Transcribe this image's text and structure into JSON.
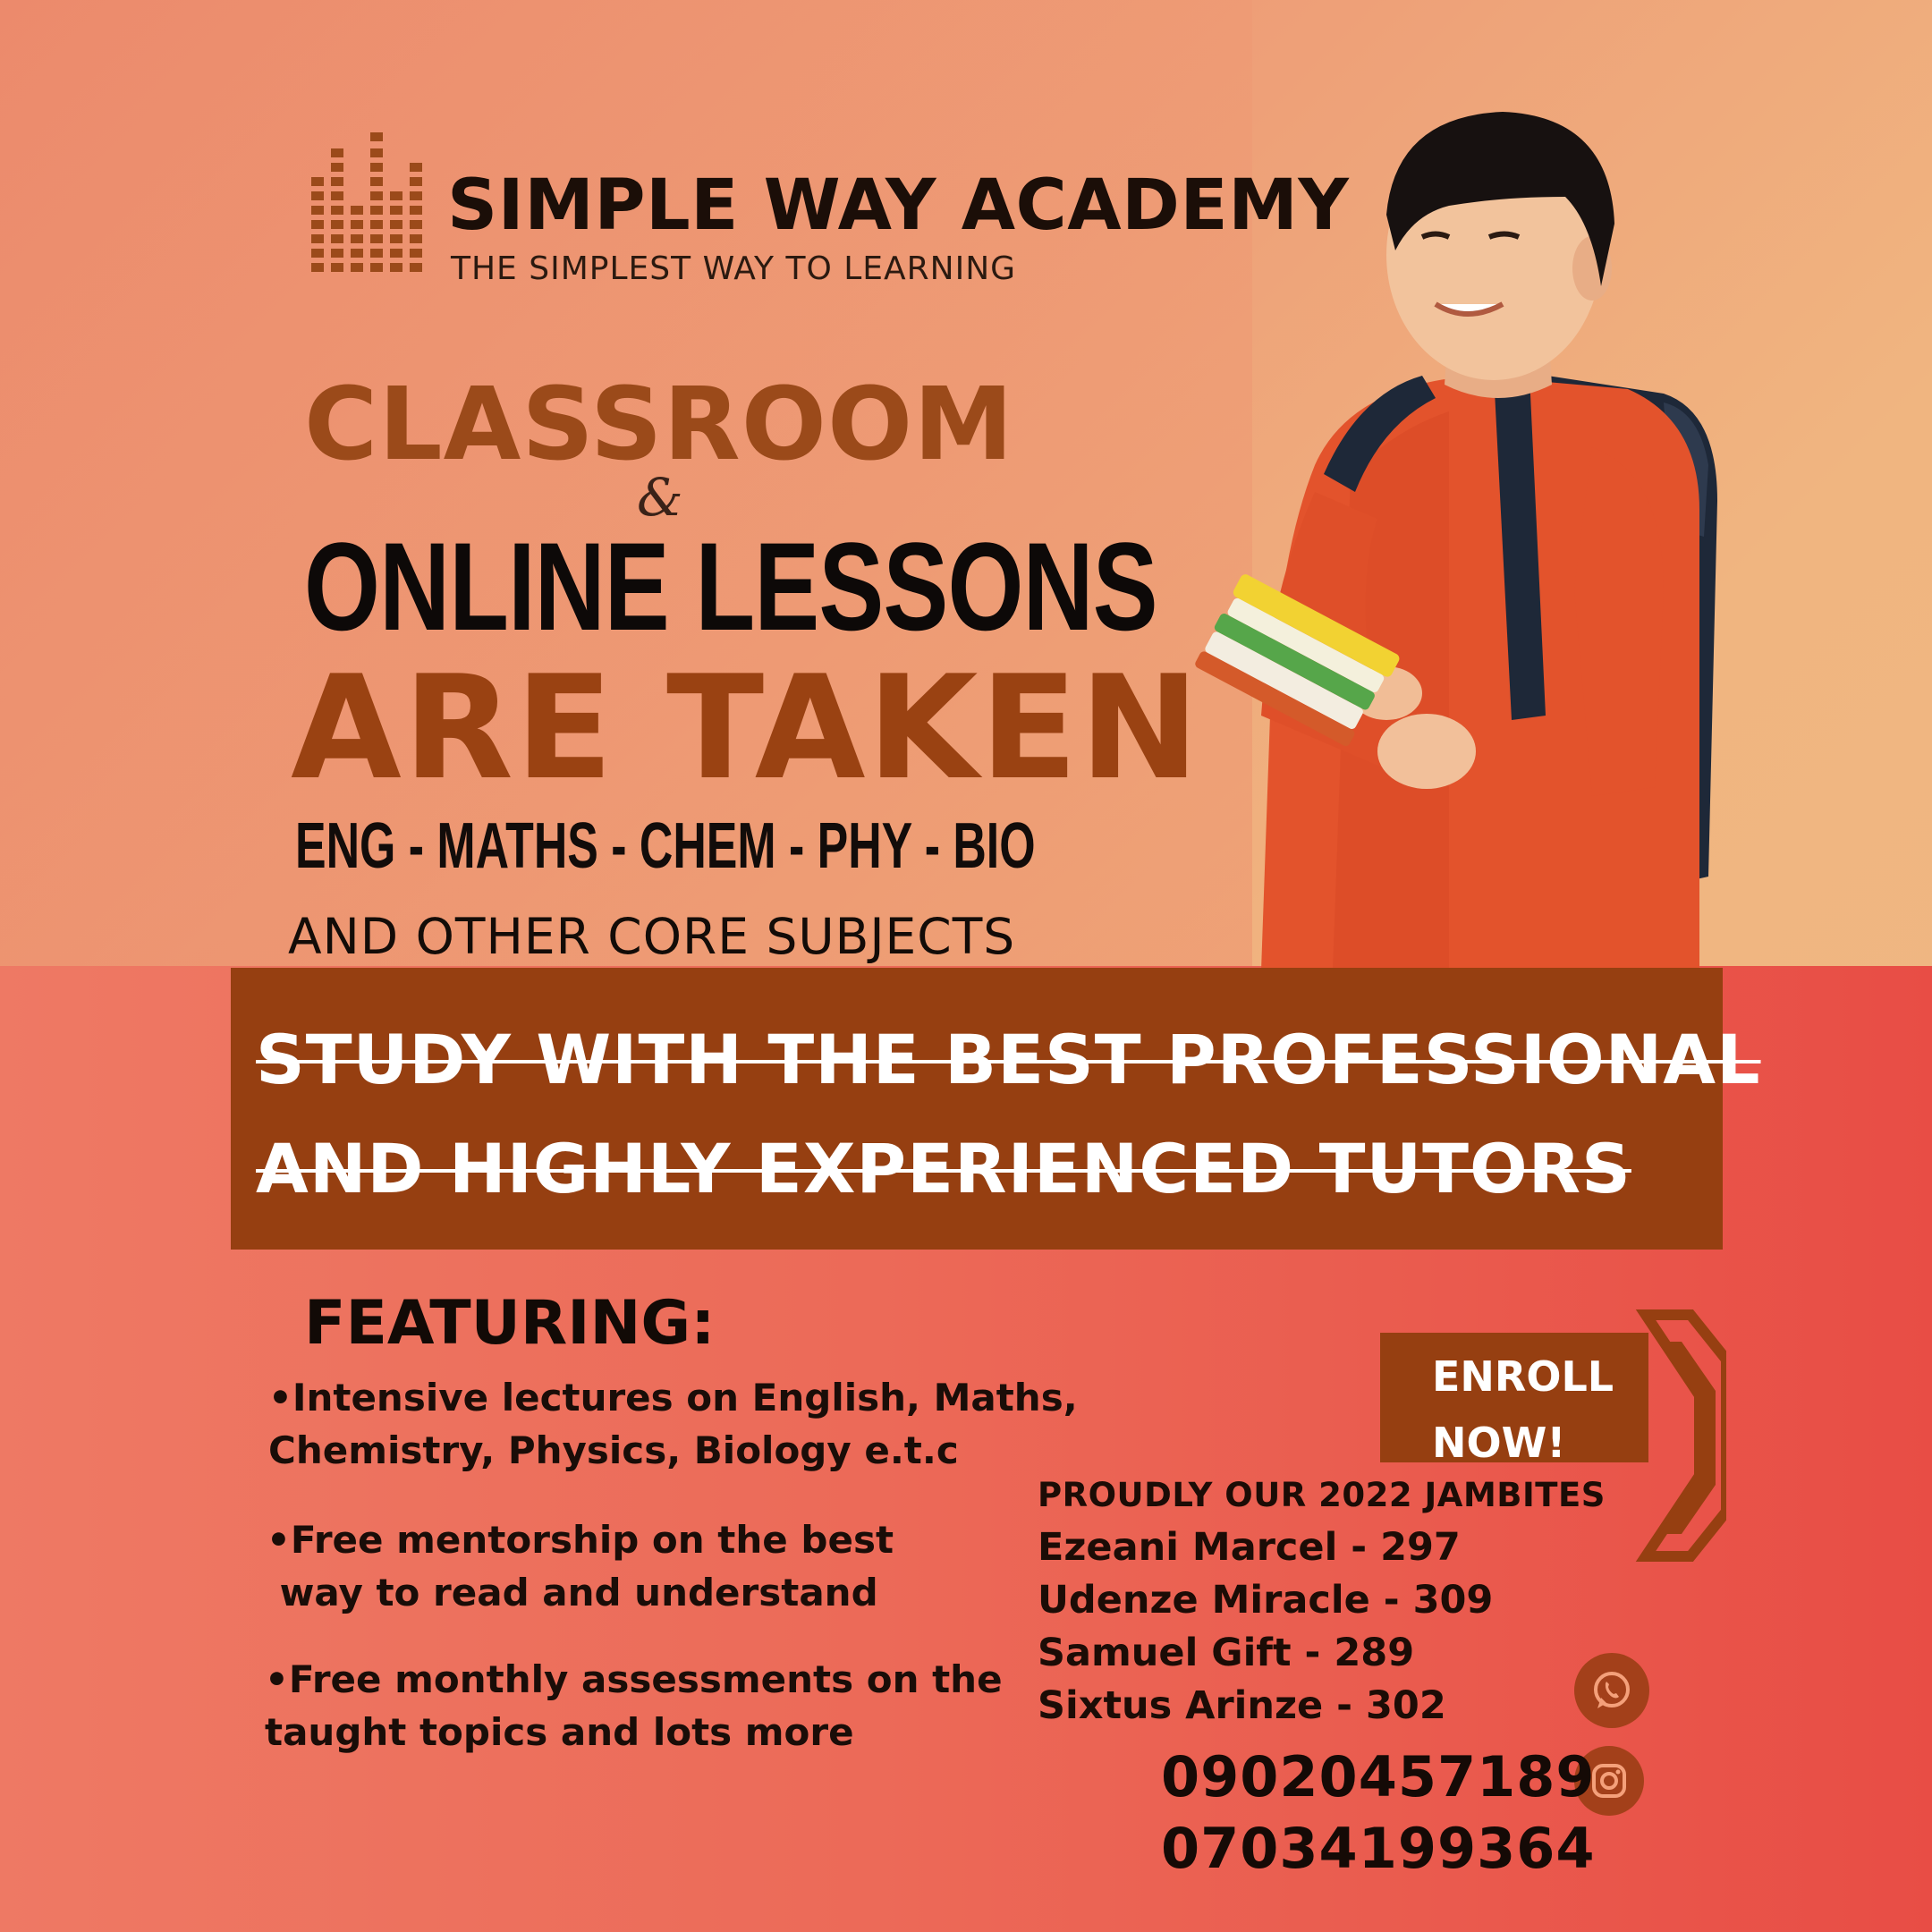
{
  "brand": {
    "name": "SIMPLE WAY ACADEMY",
    "tagline": "THE SIMPLEST WAY TO LEARNING"
  },
  "headline": {
    "line1": "CLASSROOM",
    "amp": "&",
    "line2": "ONLINE LESSONS",
    "line3": "ARE TAKEN"
  },
  "subjects": "ENG - MATHS - CHEM - PHY - BIO",
  "subjects_note": "AND OTHER CORE SUBJECTS",
  "banner": {
    "line1": "STUDY WITH THE BEST PROFESSIONAL",
    "line2": "AND HIGHLY EXPERIENCED TUTORS"
  },
  "featuring": {
    "title": "FEATURING:",
    "items": [
      "•Intensive lectures on English, Maths,\nChemistry, Physics, Biology e.t.c",
      "•Free mentorship on the best\n way to read and understand",
      "•Free monthly assessments on the\ntaught topics and lots more"
    ]
  },
  "enroll": {
    "label": "ENROLL\nNOW!"
  },
  "jambites": {
    "title": "PROUDLY OUR 2022 JAMBITES",
    "entries": [
      "Ezeani Marcel - 297",
      "Udenze Miracle - 309",
      "Samuel Gift - 289",
      "Sixtus Arinze - 302"
    ]
  },
  "contact": {
    "phones": [
      "09020457189",
      "07034199364"
    ]
  },
  "icons": {
    "logo": "equalizer-bars-logo",
    "whatsapp": "whatsapp-icon",
    "instagram": "instagram-icon"
  },
  "colors": {
    "brown": "#963f11",
    "title_brown": "#9b4a1a",
    "text_dark": "#1b0e08",
    "red": "#e84d45"
  }
}
